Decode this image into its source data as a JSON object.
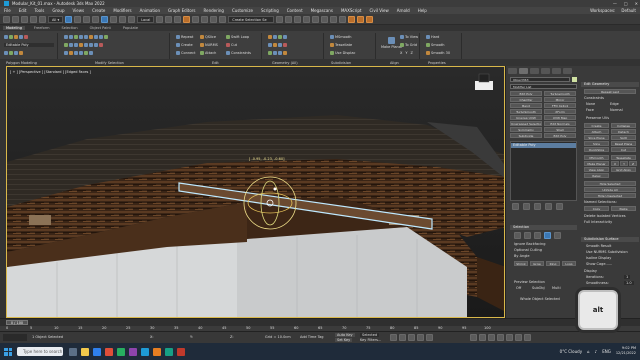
{
  "window": {
    "title": "Modular_Kit_01.max - Autodesk 3ds Max 2022",
    "controls": [
      "—",
      "□",
      "✕"
    ]
  },
  "menu": {
    "items": [
      "File",
      "Edit",
      "Tools",
      "Group",
      "Views",
      "Create",
      "Modifiers",
      "Animation",
      "Graph Editors",
      "Rendering",
      "Customize",
      "Scripting",
      "Content",
      "Megascans",
      "MAXScript",
      "Civil View",
      "Arnold",
      "Help"
    ],
    "workspace_label": "Workspaces:",
    "workspace_value": "Default"
  },
  "toolbar": {
    "view_select": "Local",
    "selection_set": "Create Selection Se"
  },
  "ribbon_tabs": [
    "Modeling",
    "Freeform",
    "Selection",
    "Object Paint",
    "Populate"
  ],
  "ribbon": {
    "left_label": "Editable Poly",
    "groups": [
      "Polygon Modeling",
      "Modify Selection",
      "Edit",
      "Geometry (All)",
      "Subdivision",
      "Align",
      "Properties"
    ],
    "edit_buttons": [
      "Repeat",
      "QSlice",
      "Swift Loop",
      "Create",
      "NURMS",
      "Cut",
      "Connect",
      "Attach",
      "Constraints"
    ],
    "subdivision_buttons": [
      "MSmooth",
      "Tessellate",
      "Use Displac"
    ],
    "align_buttons": [
      "Make Planar",
      "To View",
      "To Grid",
      "X",
      "Y",
      "Z"
    ],
    "props_buttons": [
      "Hard",
      "Smooth",
      "Smooth 30"
    ]
  },
  "viewport": {
    "label": "[ + ] [Perspective ] [Standard ] [Edged Faces ]",
    "gizmo_readout": "[ -0.95, -0.23, -0.60]"
  },
  "command_panel": {
    "object_name": "Object363",
    "modifier_list": "Modifier List",
    "modifier_buttons": [
      "Edit Poly",
      "Turbosmooth",
      "Chamfer",
      "Mirror",
      "Bend",
      "FFD 4x4x4",
      "TurboSmooth",
      "XForm",
      "Unwrap UVW",
      "UVW Map",
      "Unwrapped Selection",
      "Edit Normals",
      "Symmetry",
      "Shell",
      "Subdivide",
      "Edit Poly"
    ],
    "stack_items": [
      "Editable Poly"
    ],
    "selection_title": "Selection",
    "ignore_backfacing": "Ignore Backfacing",
    "optional_culling": "Optional Culling",
    "by_angle": "By Angle",
    "shrink": "Shrink",
    "grow": "Grow",
    "ring": "Ring",
    "loop": "Loop",
    "preview_selection": "Preview Selection",
    "preview_off": "Off",
    "preview_subobj": "SubObj",
    "preview_multi": "Multi",
    "whole_object": "Whole Object Selected",
    "edit_geometry_title": "Edit Geometry",
    "repeat_last": "Repeat Last",
    "constraints_label": "Constraints",
    "constraint_options": [
      "None",
      "Edge",
      "Face",
      "Normal"
    ],
    "preserve_uvs": "Preserve UVs",
    "geo_buttons": [
      "Create",
      "Collapse",
      "Attach",
      "Detach",
      "Slice Plane",
      "Split",
      "Slice",
      "Reset Plane",
      "QuickSlice",
      "Cut",
      "MSmooth",
      "Tessellate",
      "Make Planar",
      "X",
      "Y",
      "Z",
      "View Align",
      "Grid Align",
      "Relax"
    ],
    "hide_buttons": [
      "Hide Selected",
      "Unhide All",
      "Hide Unselected"
    ],
    "named_selections": "Named Selections:",
    "copy": "Copy",
    "paste": "Paste",
    "delete_isolated": "Delete Isolated Vertices",
    "full_interactivity": "Full Interactivity",
    "subdivision_title": "Subdivision Surface",
    "smooth_result": "Smooth Result",
    "use_nurms": "Use NURMS Subdivision",
    "isoline_display": "Isoline Display",
    "show_cage": "Show Cage......",
    "display_label": "Display",
    "iterations_label": "Iterations:",
    "iterations_value": "1",
    "smoothness_label": "Smoothness:",
    "smoothness_value": "1.0"
  },
  "timeline": {
    "frame_counter": "0 / 100",
    "ticks": [
      "0",
      "5",
      "10",
      "15",
      "20",
      "25",
      "30",
      "35",
      "40",
      "45",
      "50",
      "55",
      "60",
      "65",
      "70",
      "75",
      "80",
      "85",
      "90",
      "95",
      "100"
    ]
  },
  "status": {
    "selected_text": "1 Object Selected",
    "x_label": "X:",
    "y_label": "Y:",
    "z_label": "Z:",
    "grid_text": "Grid = 10.0cm",
    "add_time_tag": "Add Time Tag",
    "auto_key": "Auto Key",
    "set_key": "Set Key",
    "selected_label": "Selected",
    "key_filters": "Key Filters..."
  },
  "key_overlay": {
    "key": "alt"
  },
  "taskbar": {
    "search_placeholder": "Type here to search",
    "weather": "0°C Cloudy",
    "language": "ENG",
    "time": "9:02 PM",
    "date": "12/21/2022"
  },
  "colors": {
    "viewport_border": "#d9b84a",
    "selection_highlight": "#b7e6ff",
    "accent": "#1e9bd6"
  }
}
